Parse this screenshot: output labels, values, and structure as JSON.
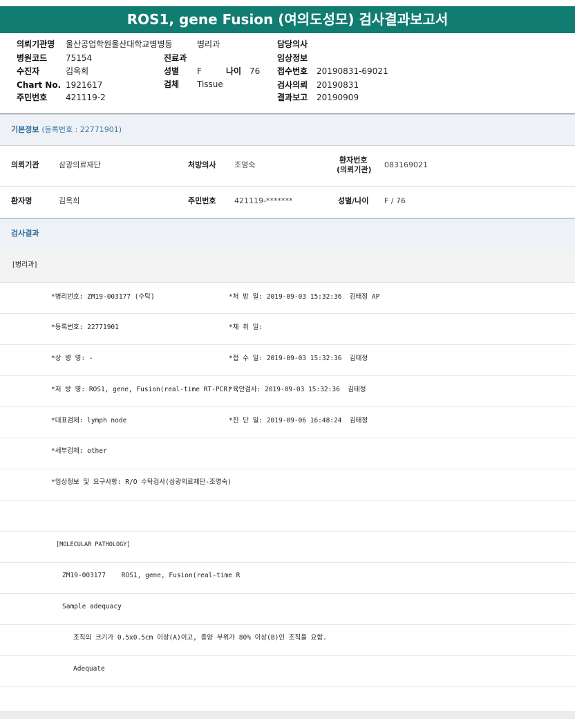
{
  "title": "ROS1, gene Fusion (여의도성모) 검사결과보고서",
  "header": {
    "col1": [
      {
        "label": "의뢰기관명",
        "value": "울산공업학원울산대학교병병동"
      },
      {
        "label": "병원코드",
        "value": "75154"
      },
      {
        "label": "수진자",
        "value": "김옥희"
      },
      {
        "label": "Chart No.",
        "value": "1921617"
      },
      {
        "label": "주민번호",
        "value": "421119-2"
      }
    ],
    "col1_extra": "병리과",
    "col2": [
      {
        "label": "진료과",
        "value": ""
      },
      {
        "label": "성별",
        "value": "F"
      },
      {
        "label": "검체",
        "value": "Tissue"
      }
    ],
    "age": {
      "label": "나이",
      "value": "76"
    },
    "col3": [
      {
        "label": "담당의사",
        "value": ""
      },
      {
        "label": "임상정보",
        "value": ""
      },
      {
        "label": "접수번호",
        "value": "20190831-69021"
      },
      {
        "label": "검사의뢰",
        "value": "20190831"
      },
      {
        "label": "결과보고",
        "value": "20190909"
      }
    ]
  },
  "basic_info": {
    "heading": "기본정보",
    "sub": "(등록번호 : 22771901)",
    "row1": {
      "agency_label": "의뢰기관",
      "agency_value": "삼광의료재단",
      "doctor_label": "처방의사",
      "doctor_value": "조영숙",
      "patient_no_label_1": "환자번호",
      "patient_no_label_2": "(의뢰기관)",
      "patient_no_value": "083169021"
    },
    "row2": {
      "name_label": "환자명",
      "name_value": "김옥희",
      "rrn_label": "주민번호",
      "rrn_value": "421119-*******",
      "sexage_label": "성별/나이",
      "sexage_value": "F / 76"
    }
  },
  "results": {
    "heading": "검사결과",
    "department": "[병리과]",
    "rows": [
      {
        "left": "*병리번호: ZM19-003177 (수탁)",
        "right": "*처 방 일: 2019-09-03 15:32:36  김태정 AP"
      },
      {
        "left": "*등록번호: 22771901",
        "right": "*채 취 일:"
      },
      {
        "left": "*상 병 명: -",
        "right": "*접 수 일: 2019-09-03 15:32:36  김태정"
      },
      {
        "left": "*처 방 명: ROS1, gene, Fusion(real-time RT-PCR)",
        "right": "*육안검사: 2019-09-03 15:32:36  김태정"
      },
      {
        "left": "*대표검체: lymph node",
        "right": "*진 단 일: 2019-09-06 16:48:24  김태정"
      },
      {
        "left": "*세부검체: other",
        "right": ""
      },
      {
        "left": "*임상정보 및 요구사항: R/O 수탁검사(삼광의료재단-조영숙)",
        "right": ""
      }
    ],
    "molecular_heading": "[MOLECULAR PATHOLOGY]",
    "molecular_line": "ZM19-003177    ROS1, gene, Fusion(real-time R",
    "sample_adequacy": "Sample adequacy",
    "adequacy_criteria": "조직의 크기가 0.5x0.5cm 이상(A)이고, 종양 부위가 80% 이상(B)인 조직을 요함.",
    "adequacy_result": "Adequate"
  }
}
